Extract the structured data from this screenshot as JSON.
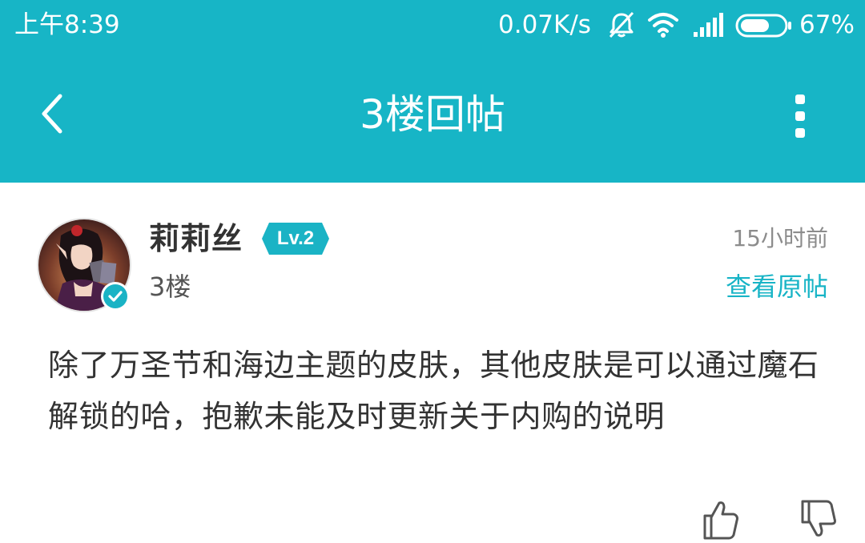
{
  "status_bar": {
    "time": "上午8:39",
    "network_speed": "0.07K/s",
    "battery_percent": "67%",
    "battery_level": 0.67,
    "icons": [
      "mute-notification-icon",
      "wifi-icon",
      "signal-icon",
      "battery-icon"
    ]
  },
  "app_bar": {
    "title": "3楼回帖",
    "back_icon": "chevron-left-icon",
    "more_icon": "more-vertical-icon"
  },
  "post": {
    "author": {
      "name": "莉莉丝",
      "level": "Lv.2",
      "verified": true
    },
    "floor": "3楼",
    "time": "15小时前",
    "view_original": "查看原帖",
    "body": "除了万圣节和海边主题的皮肤，其他皮肤是可以通过魔石解锁的哈，抱歉未能及时更新关于内购的说明"
  },
  "actions": {
    "like_icon": "thumbs-up-icon",
    "dislike_icon": "thumbs-down-icon"
  },
  "colors": {
    "primary": "#17b5c6",
    "link": "#18b4c6",
    "text": "#333333",
    "muted": "#8c8c8c"
  }
}
